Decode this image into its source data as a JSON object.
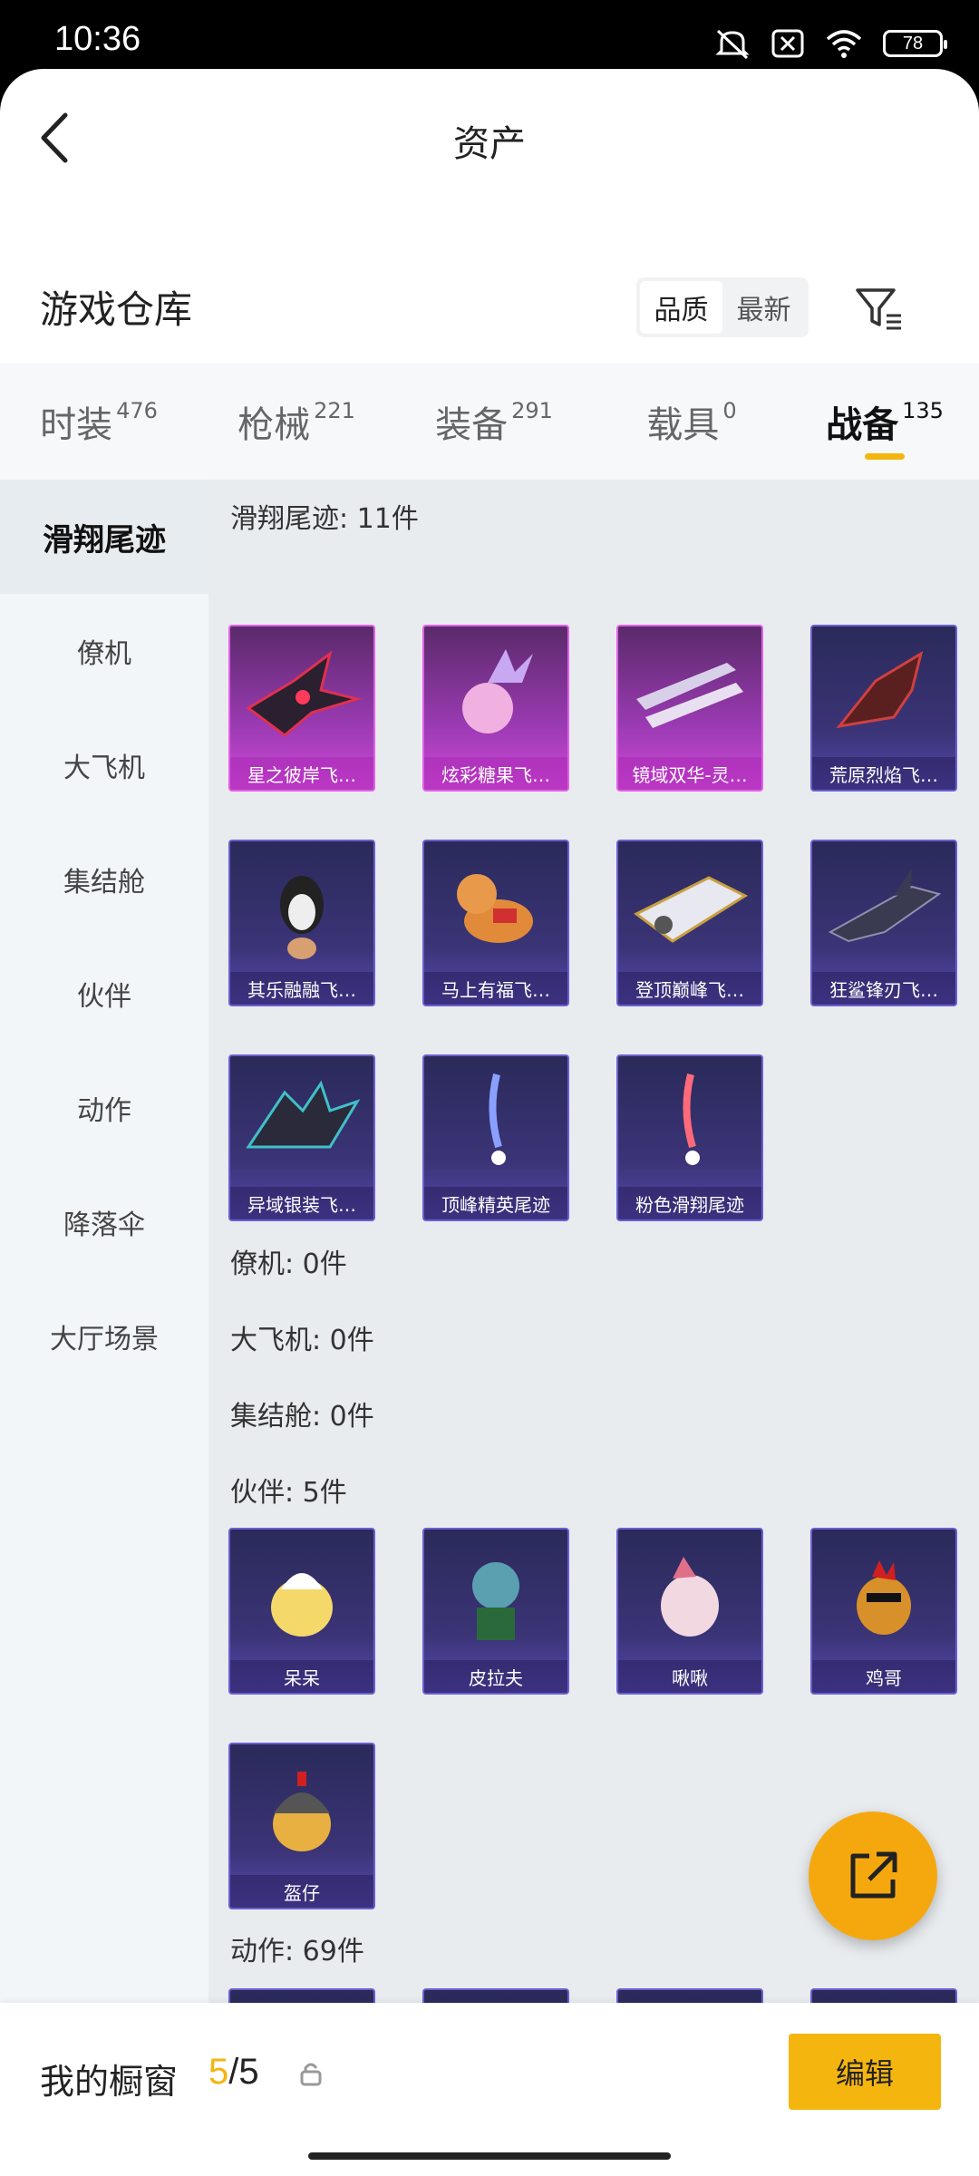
{
  "status": {
    "time": "10:36",
    "battery": "78"
  },
  "header": {
    "title": "资产"
  },
  "warehouse": {
    "title": "游戏仓库",
    "sort_quality": "品质",
    "sort_newest": "最新"
  },
  "tabs": [
    {
      "label": "时装",
      "count": "476"
    },
    {
      "label": "枪械",
      "count": "221"
    },
    {
      "label": "装备",
      "count": "291"
    },
    {
      "label": "载具",
      "count": "0"
    },
    {
      "label": "战备",
      "count": "135",
      "active": true
    }
  ],
  "sidebar": {
    "items": [
      {
        "label": "滑翔尾迹",
        "active": true
      },
      {
        "label": "僚机"
      },
      {
        "label": "大飞机"
      },
      {
        "label": "集结舱"
      },
      {
        "label": "伙伴"
      },
      {
        "label": "动作"
      },
      {
        "label": "降落伞"
      },
      {
        "label": "大厅场景"
      }
    ]
  },
  "categories": {
    "glide_trail": {
      "label": "滑翔尾迹: 11件",
      "items": [
        {
          "name": "星之彼岸飞…",
          "rarity": "pink"
        },
        {
          "name": "炫彩糖果飞…",
          "rarity": "pink"
        },
        {
          "name": "镜域双华-灵…",
          "rarity": "pink"
        },
        {
          "name": "荒原烈焰飞…",
          "rarity": "purple"
        },
        {
          "name": "其乐融融飞…",
          "rarity": "purple"
        },
        {
          "name": "马上有福飞…",
          "rarity": "purple"
        },
        {
          "name": "登顶巅峰飞…",
          "rarity": "purple"
        },
        {
          "name": "狂鲨锋刃飞…",
          "rarity": "purple"
        },
        {
          "name": "异域银装飞…",
          "rarity": "purple"
        },
        {
          "name": "顶峰精英尾迹",
          "rarity": "purple"
        },
        {
          "name": "粉色滑翔尾迹",
          "rarity": "purple"
        }
      ]
    },
    "wingman": {
      "label": "僚机: 0件"
    },
    "big_plane": {
      "label": "大飞机: 0件"
    },
    "rally_pod": {
      "label": "集结舱: 0件"
    },
    "partner": {
      "label": "伙伴: 5件",
      "items": [
        {
          "name": "呆呆",
          "rarity": "purple"
        },
        {
          "name": "皮拉夫",
          "rarity": "purple"
        },
        {
          "name": "啾啾",
          "rarity": "purple"
        },
        {
          "name": "鸡哥",
          "rarity": "purple"
        },
        {
          "name": "盔仔",
          "rarity": "purple"
        }
      ]
    },
    "emote": {
      "label": "动作: 69件"
    }
  },
  "showcase": {
    "label": "我的橱窗",
    "current": "5",
    "total": "/5",
    "edit_label": "编辑"
  },
  "colors": {
    "accent": "#f5b50f",
    "fab": "#f5a80e"
  }
}
